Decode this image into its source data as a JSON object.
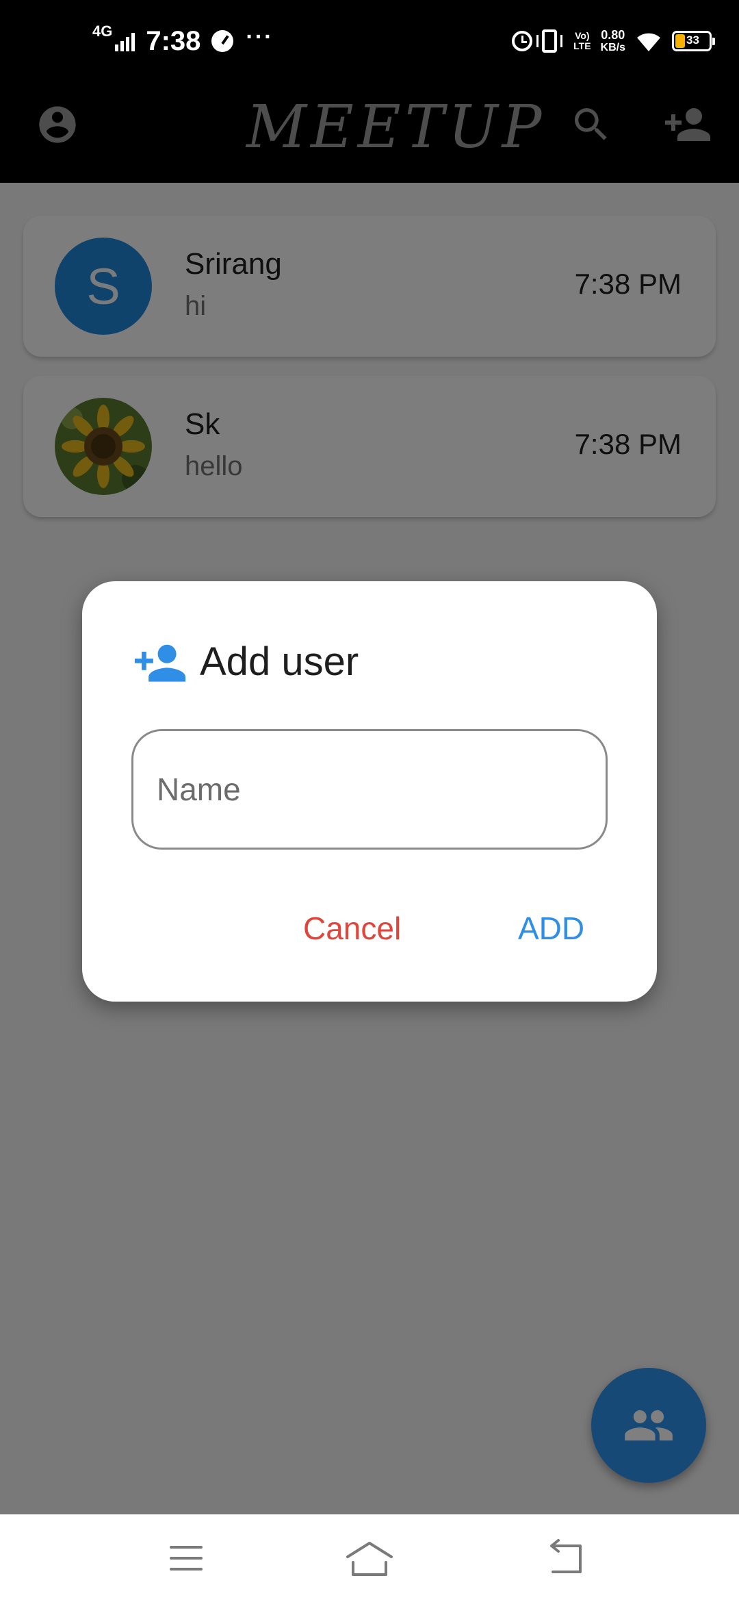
{
  "status_bar": {
    "network": "4G",
    "time": "7:38",
    "dots": "···",
    "volte_top": "Vo)",
    "volte_bottom": "LTE",
    "speed_value": "0.80",
    "speed_unit": "KB/s",
    "battery_level": "33",
    "battery_color": "#f5b200"
  },
  "app_bar": {
    "title": "MEETUP",
    "icons": [
      "account-icon",
      "search-icon",
      "add-user-icon"
    ]
  },
  "chats": [
    {
      "name": "Srirang",
      "last_message": "hi",
      "time": "7:38 PM",
      "avatar_letter": "S",
      "avatar_color": "#1f87d8"
    },
    {
      "name": "Sk",
      "last_message": "hello",
      "time": "7:38 PM",
      "avatar": "sunflower-photo"
    }
  ],
  "dialog": {
    "icon": "add-user-icon",
    "title": "Add user",
    "name_placeholder": "Name",
    "name_value": "",
    "cancel_label": "Cancel",
    "add_label": "ADD",
    "cancel_color": "#e0443a",
    "add_color": "#2f8ee6"
  },
  "fab": {
    "icon": "group-icon",
    "color": "#2f93ee"
  },
  "nav_bar": {
    "icons": [
      "menu-icon",
      "home-icon",
      "back-icon"
    ]
  }
}
